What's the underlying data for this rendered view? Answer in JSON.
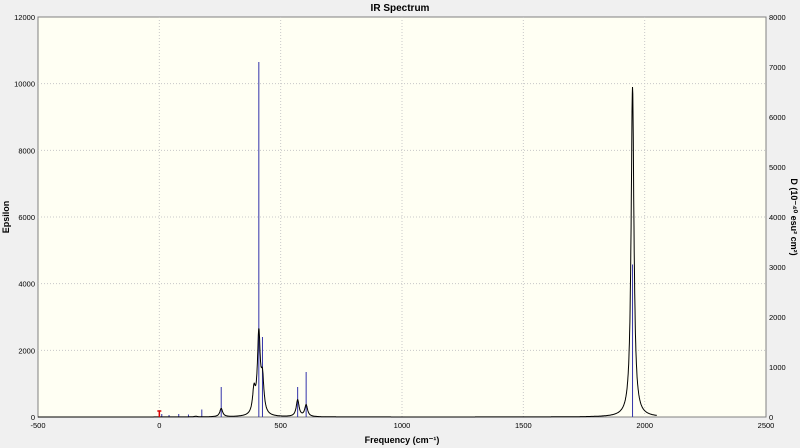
{
  "chart_data": {
    "type": "line",
    "title": "IR Spectrum",
    "xlabel": "Frequency (cm⁻¹)",
    "ylabel_left": "Epsilon",
    "ylabel_right": "D (10⁻⁴⁰ esu² cm²)",
    "xlim": [
      -500,
      2500
    ],
    "ylim_left": [
      0,
      12000
    ],
    "ylim_right": [
      0,
      8000
    ],
    "x_ticks": [
      -500,
      0,
      500,
      1000,
      1500,
      2000,
      2500
    ],
    "y_left_ticks": [
      0,
      2000,
      4000,
      6000,
      8000,
      10000,
      12000
    ],
    "y_right_ticks": [
      0,
      1000,
      2000,
      3000,
      4000,
      5000,
      6000,
      7000,
      8000
    ],
    "grid": true,
    "colors": {
      "background": "#fffff3",
      "spectrum": "#000000",
      "sticks": "#3333aa",
      "grid": "#c8c8c8",
      "imaginary": "#dd0000"
    },
    "series": [
      {
        "values": [
          {
            "x": 10,
            "d": 60
          },
          {
            "x": 40,
            "d": 40
          },
          {
            "x": 80,
            "d": 60
          },
          {
            "x": 120,
            "d": 50
          },
          {
            "x": 175,
            "d": 150
          },
          {
            "x": 255,
            "d": 600
          },
          {
            "x": 410,
            "d": 7100
          },
          {
            "x": 425,
            "d": 1600
          },
          {
            "x": 570,
            "d": 600
          },
          {
            "x": 605,
            "d": 900
          },
          {
            "x": 1950,
            "d": 3050
          }
        ]
      },
      {
        "values": [
          {
            "x": -500,
            "y": 0
          },
          {
            "x": 150,
            "y": 20
          },
          {
            "x": 255,
            "y": 250
          },
          {
            "x": 390,
            "y": 700
          },
          {
            "x": 410,
            "y": 2400
          },
          {
            "x": 425,
            "y": 1000
          },
          {
            "x": 570,
            "y": 500
          },
          {
            "x": 605,
            "y": 350
          },
          {
            "x": 1950,
            "y": 9900
          },
          {
            "x": 2050,
            "y": 0
          }
        ]
      }
    ]
  }
}
